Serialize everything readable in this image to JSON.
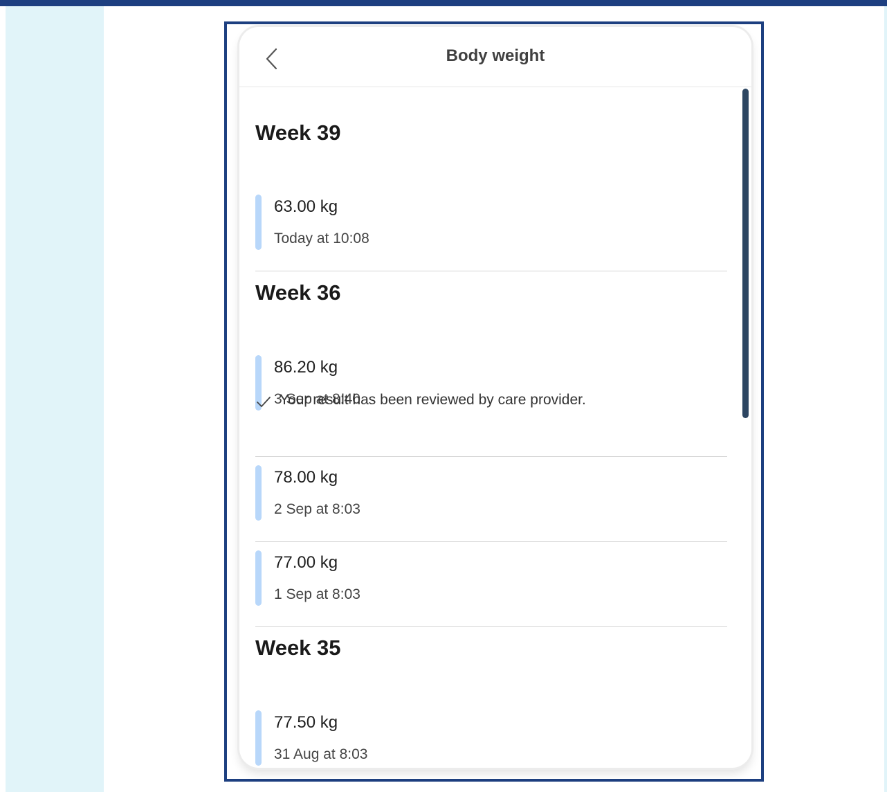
{
  "header": {
    "title": "Body weight",
    "back_icon": "chevron-left-icon"
  },
  "weeks": [
    {
      "title": "Week 39",
      "entries": [
        {
          "value": "63.00 kg",
          "time": "Today at 10:08"
        }
      ]
    },
    {
      "title": "Week 36",
      "entries": [
        {
          "value": "86.20 kg",
          "time": "3 Sep at 8:40",
          "review_note": "Your result has been reviewed by care provider."
        },
        {
          "value": "78.00 kg",
          "time": "2 Sep at 8:03"
        },
        {
          "value": "77.00 kg",
          "time": "1 Sep at 8:03"
        }
      ]
    },
    {
      "title": "Week 35",
      "entries": [
        {
          "value": "77.50 kg",
          "time": "31 Aug at 8:03"
        }
      ]
    }
  ],
  "colors": {
    "accent_bar": "#b8d7fa",
    "frame_border": "#1d3f80",
    "side_panel": "#e1f4f9",
    "scrollbar": "#2d4662"
  },
  "icons": {
    "review": "checkmark-icon"
  }
}
